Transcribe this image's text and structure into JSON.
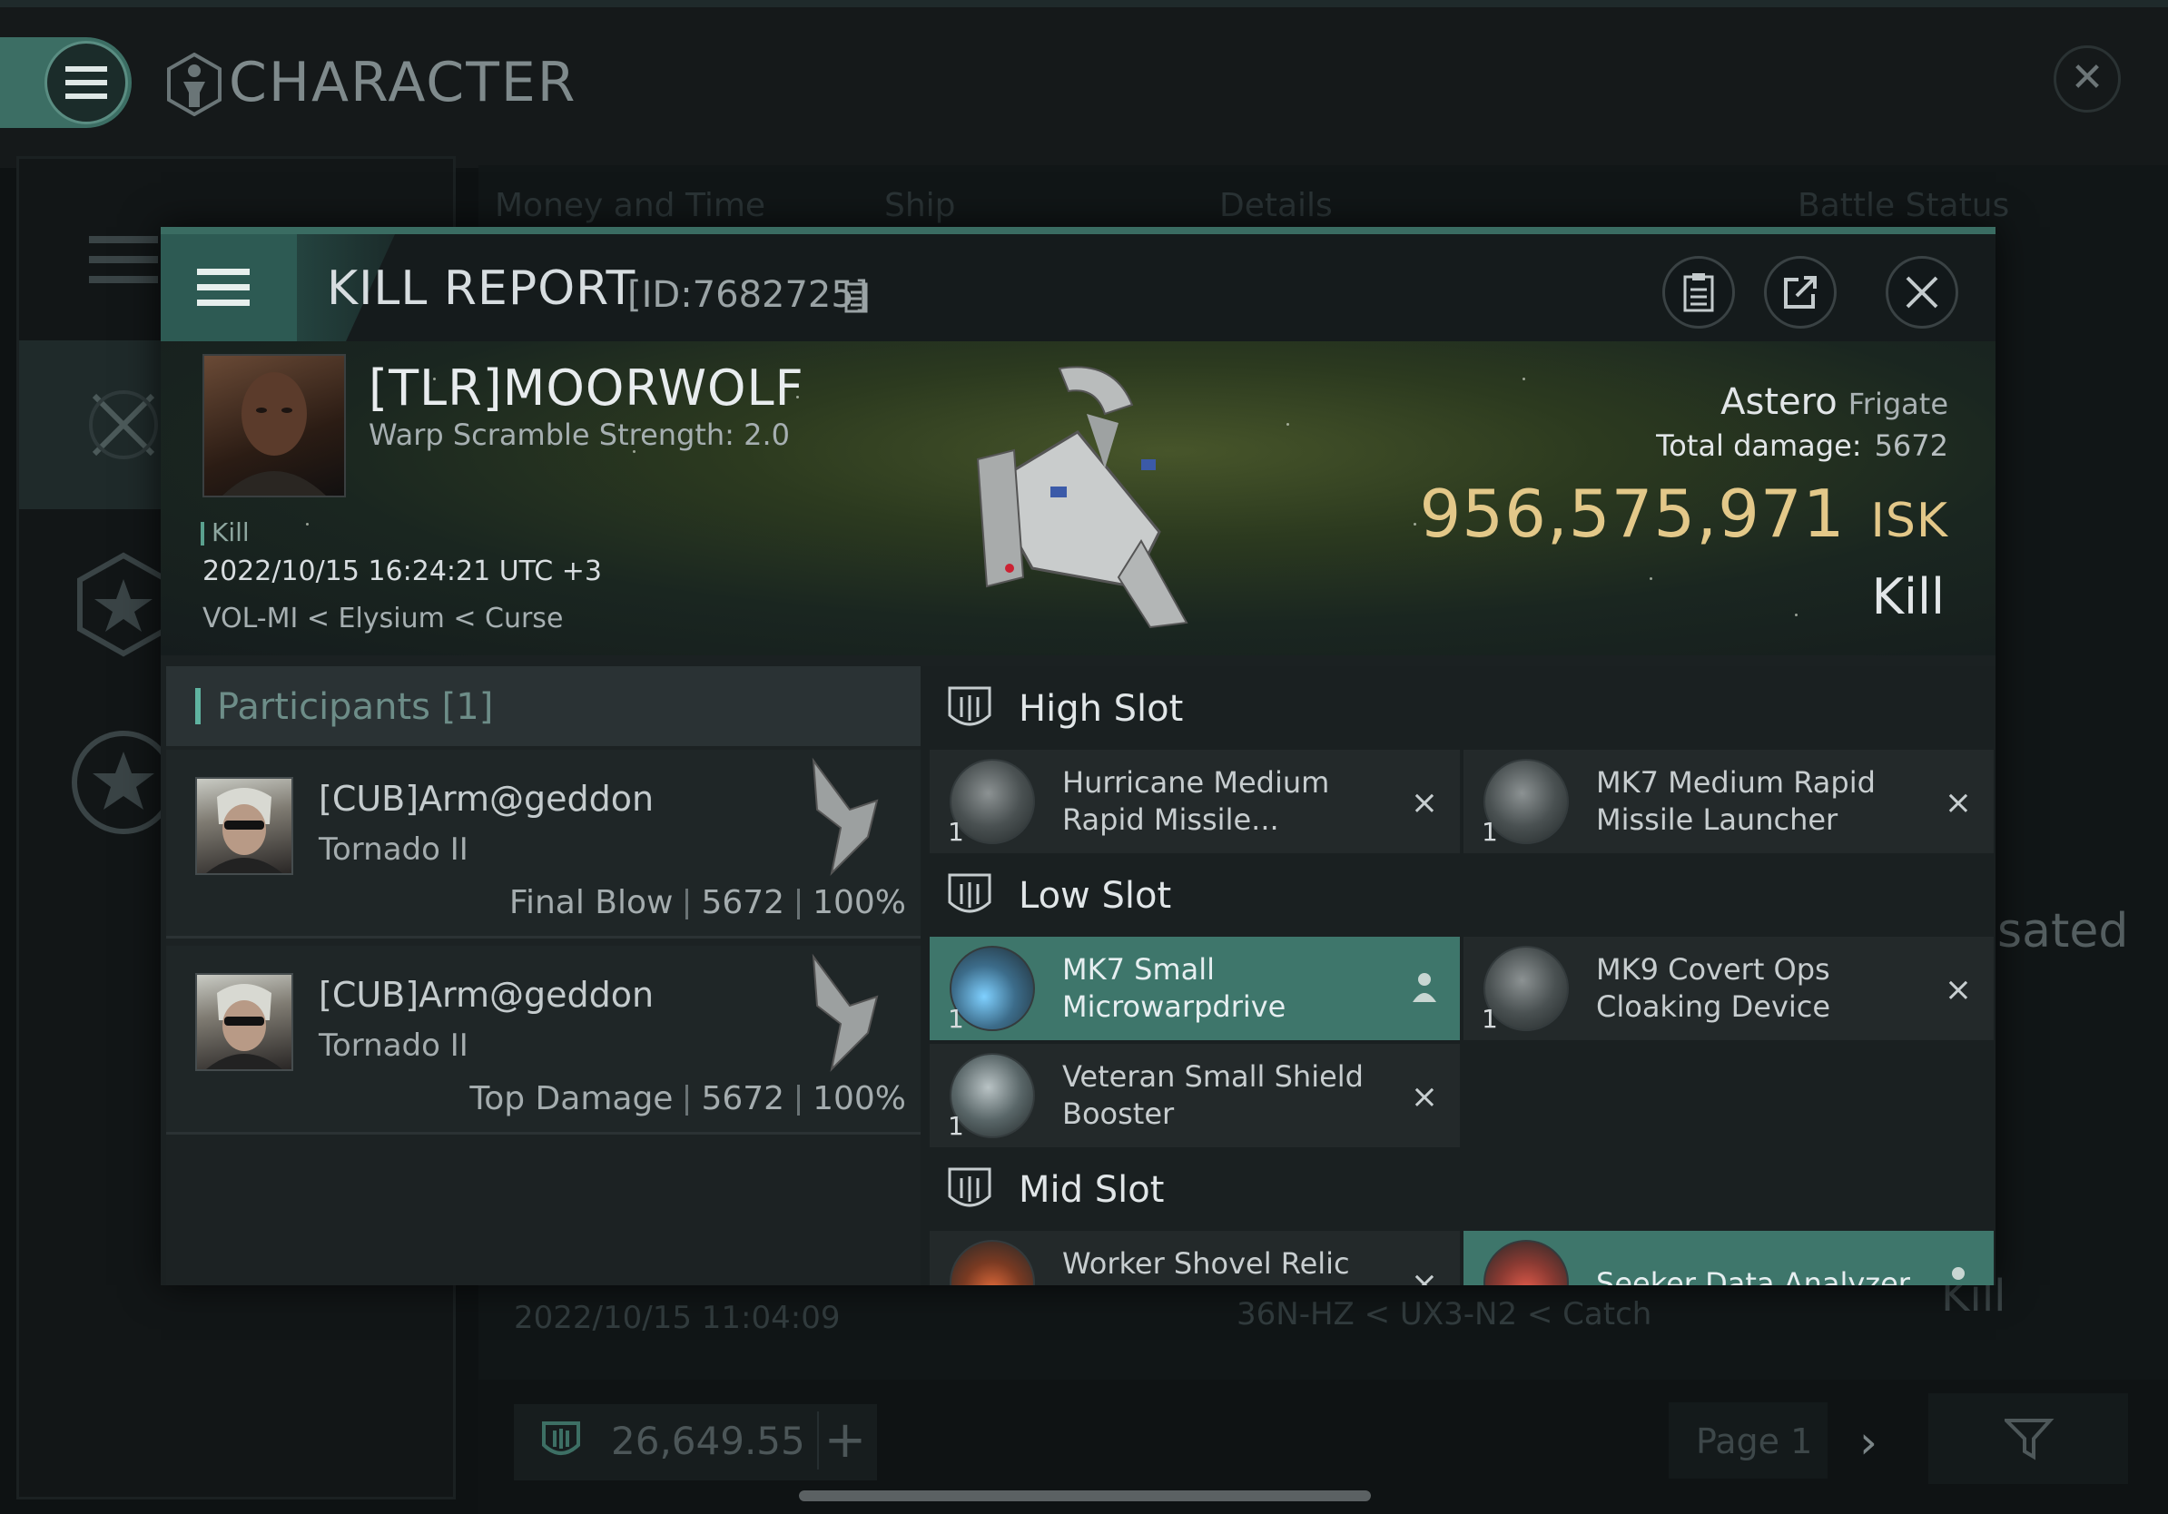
{
  "app": {
    "title": "CHARACTER",
    "bg_columns": [
      "Money and Time",
      "Ship",
      "Details",
      "Battle Status"
    ],
    "bg_partial_text": "sated",
    "bg_row_date": "2022/10/15 11:04:09",
    "bg_row_location": "36N-HZ < UX3-N2 < Catch",
    "bg_row_result": "Kill",
    "isk_balance": "26,649.55",
    "page_label": "Page 1"
  },
  "modal": {
    "title": "KILL REPORT",
    "report_id": "[ID:7682725]",
    "pilot": {
      "name": "[TLR]MOORWOLF",
      "warp_scramble": "Warp Scramble Strength: 2.0",
      "tag": "Kill",
      "datetime": "2022/10/15 16:24:21 UTC +3",
      "location": "VOL-MI < Elysium < Curse"
    },
    "ship": {
      "name": "Astero",
      "class": "Frigate",
      "total_damage_label": "Total damage:",
      "total_damage": "5672",
      "isk_value": "956,575,971",
      "isk_unit": "ISK",
      "result": "Kill"
    },
    "participants": {
      "title": "Participants [1]",
      "rows": [
        {
          "name": "[CUB]Arm@geddon",
          "ship": "Tornado II",
          "role": "Final Blow",
          "damage": "5672",
          "percent": "100%"
        },
        {
          "name": "[CUB]Arm@geddon",
          "ship": "Tornado II",
          "role": "Top Damage",
          "damage": "5672",
          "percent": "100%"
        }
      ]
    },
    "fitting": {
      "high_slot": {
        "label": "High Slot",
        "modules": [
          {
            "qty": "1",
            "name": "Hurricane Medium Rapid Missile...",
            "status": "destroyed"
          },
          {
            "qty": "1",
            "name": "MK7 Medium Rapid Missile Launcher",
            "status": "destroyed"
          }
        ]
      },
      "low_slot": {
        "label": "Low Slot",
        "modules": [
          {
            "qty": "1",
            "name": "MK7 Small Microwarpdrive",
            "status": "dropped"
          },
          {
            "qty": "1",
            "name": "MK9 Covert Ops Cloaking Device",
            "status": "destroyed"
          },
          {
            "qty": "1",
            "name": "Veteran Small Shield Booster",
            "status": "destroyed"
          }
        ]
      },
      "mid_slot": {
        "label": "Mid Slot",
        "modules": [
          {
            "name": "Worker Shovel Relic",
            "status": "destroyed"
          },
          {
            "name": "Seeker Data Analyzer",
            "status": "dropped"
          }
        ]
      }
    },
    "icons": {
      "destroyed": "×",
      "dropped": "person-icon"
    },
    "colors": {
      "accent": "#3e766b",
      "isk": "#e3c889",
      "participants_title": "#6d8d88"
    }
  }
}
